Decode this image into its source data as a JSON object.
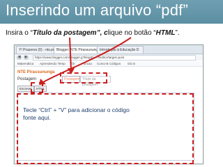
{
  "slide": {
    "title": "Inserindo um arquivo “pdf”",
    "subtitle_prefix": "Insira o “",
    "subtitle_bold1": "Título da postagem”, c",
    "subtitle_mid": "lique no botão “",
    "subtitle_bold2": "HTML",
    "subtitle_suffix": "”.",
    "instruction": "Tecle “Ctrl” + “V” para adicionar o código fonte aqui."
  },
  "browser": {
    "tabs": [
      {
        "label": "Y! Prazeres (0) - nts.pmpassos"
      },
      {
        "label": "Blogger: NTE Pirassununga"
      },
      {
        "label": "Introdução à Educação D"
      }
    ],
    "url": "https://www.blogger.com/blogger.g?blogID=...#editor/target=post",
    "bookmarks": [
      "Matemática",
      "Aprendendo Temp",
      "Zôr",
      "Funcao",
      "Curso-B Códigos",
      "Glo E"
    ]
  },
  "editor": {
    "logo": "NTE Pirassununga",
    "post_title_label": "Postagem",
    "post_title_value": "Postagem",
    "post_title_placeholder": "Título da postagem",
    "mode_compose": "Escrever",
    "mode_html": "HTML"
  },
  "colors": {
    "header_bg": "#6f9fb1",
    "annotation_red": "#cc1f1f",
    "instruction_text": "#1f3d6b"
  }
}
